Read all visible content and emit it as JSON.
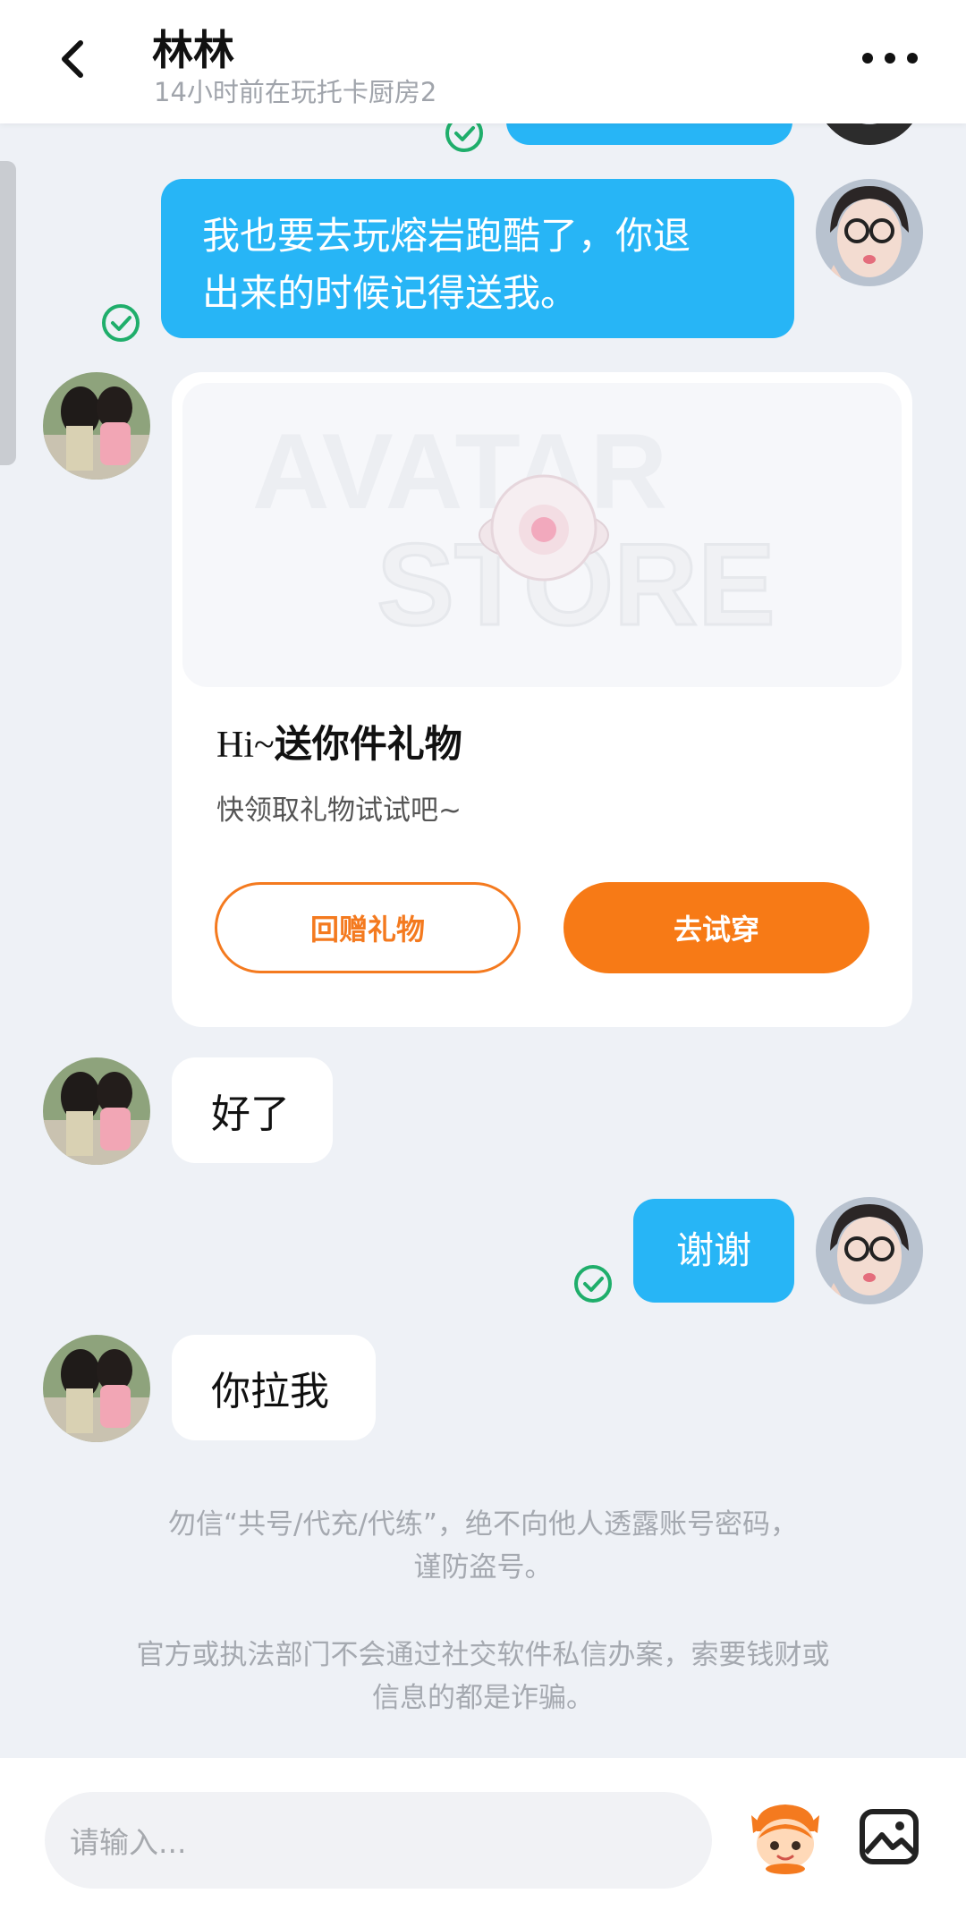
{
  "header": {
    "title": "林林",
    "subtitle": "14小时前在玩托卡厨房2"
  },
  "messages": {
    "m1_text_line1": "我也要去玩熔岩跑酷了，你退",
    "m1_text_line2": "出来的时候记得送我。",
    "m3_text": "好了",
    "m4_text": "谢谢",
    "m5_text": "你拉我"
  },
  "gift_card": {
    "banner_watermark_line1": "AVATAR",
    "banner_watermark_line2": "STORE",
    "title_prefix": "Hi~",
    "title_main": "送你件礼物",
    "description": "快领取礼物试试吧~",
    "return_gift_label": "回赠礼物",
    "try_on_label": "去试穿"
  },
  "notices": {
    "line1": "勿信“共号/代充/代练”，绝不向他人透露账号密码，",
    "line2": "谨防盗号。",
    "line3": "官方或执法部门不会通过社交软件私信办案，索要钱财或",
    "line4": "信息的都是诈骗。"
  },
  "input": {
    "placeholder": "请输入..."
  },
  "colors": {
    "accent_blue": "#27b5f6",
    "accent_orange": "#f77a16",
    "sent_check": "#1fae6b"
  },
  "icons": {
    "back": "chevron-left-icon",
    "more": "more-dots-icon",
    "sent": "check-circle-icon",
    "emoji": "mascot-emoji-icon",
    "image": "image-icon"
  }
}
